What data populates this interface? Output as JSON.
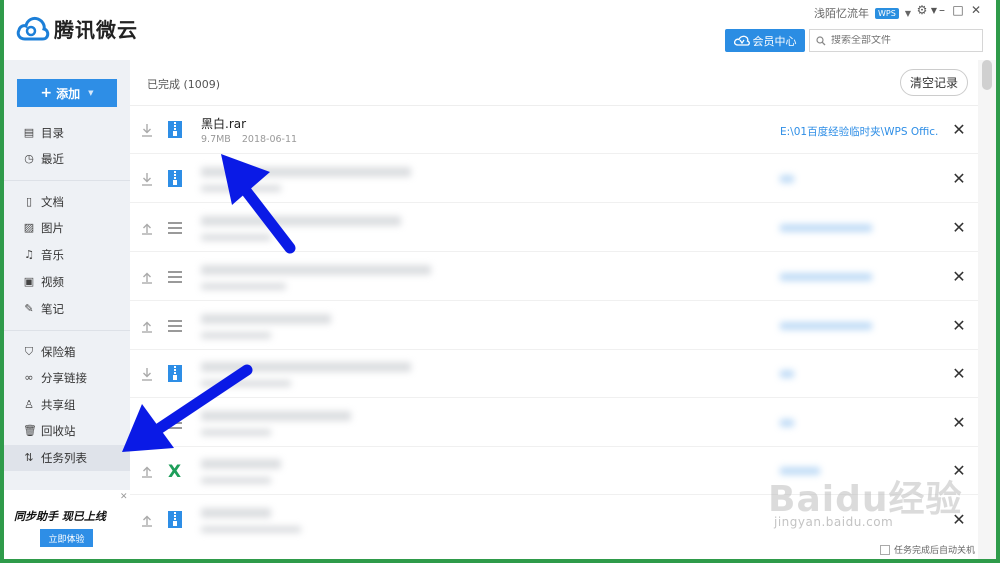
{
  "app": {
    "title": "腾讯微云"
  },
  "header": {
    "username": "浅陌忆流年",
    "user_badge": "WPS",
    "member_button": "会员中心",
    "search": {
      "placeholder": "搜索全部文件",
      "value": ""
    },
    "accent_color": "#2b8de3"
  },
  "sidebar": {
    "add_button": "添加",
    "groups": [
      [
        {
          "label": "目录",
          "icon": "directory-icon"
        },
        {
          "label": "最近",
          "icon": "clock-icon"
        }
      ],
      [
        {
          "label": "文档",
          "icon": "document-icon"
        },
        {
          "label": "图片",
          "icon": "image-icon"
        },
        {
          "label": "音乐",
          "icon": "music-icon"
        },
        {
          "label": "视频",
          "icon": "video-icon"
        },
        {
          "label": "笔记",
          "icon": "note-icon"
        }
      ],
      [
        {
          "label": "保险箱",
          "icon": "shield-icon"
        },
        {
          "label": "分享链接",
          "icon": "link-icon"
        },
        {
          "label": "共享组",
          "icon": "group-icon"
        },
        {
          "label": "回收站",
          "icon": "trash-icon"
        },
        {
          "label": "任务列表",
          "icon": "task-list-icon",
          "active": true
        }
      ]
    ],
    "promo": {
      "title": "同步助手 现已上线",
      "button": "立即体验"
    }
  },
  "main": {
    "completed_label": "已完成 (1009)",
    "clear_button": "清空记录",
    "tasks": [
      {
        "name": "黑白.rar",
        "size": "9.7MB",
        "date": "2018-06-11",
        "path": "E:\\01百度经验临时夹\\WPS Offic...",
        "direction": "download",
        "type": "archive",
        "blurred": false
      },
      {
        "direction": "download",
        "type": "archive",
        "blurred": true
      },
      {
        "direction": "upload",
        "type": "generic",
        "blurred": true
      },
      {
        "direction": "upload",
        "type": "generic",
        "blurred": true
      },
      {
        "direction": "upload",
        "type": "generic",
        "blurred": true
      },
      {
        "direction": "download",
        "type": "archive",
        "blurred": true
      },
      {
        "direction": "upload",
        "type": "generic",
        "blurred": true
      },
      {
        "direction": "upload",
        "type": "excel",
        "blurred": true
      },
      {
        "direction": "upload",
        "type": "archive",
        "blurred": true
      }
    ],
    "auto_shutdown_label": "任务完成后自动关机"
  },
  "watermark": {
    "text": "Baidu经验",
    "sub": "jingyan.baidu.com"
  }
}
